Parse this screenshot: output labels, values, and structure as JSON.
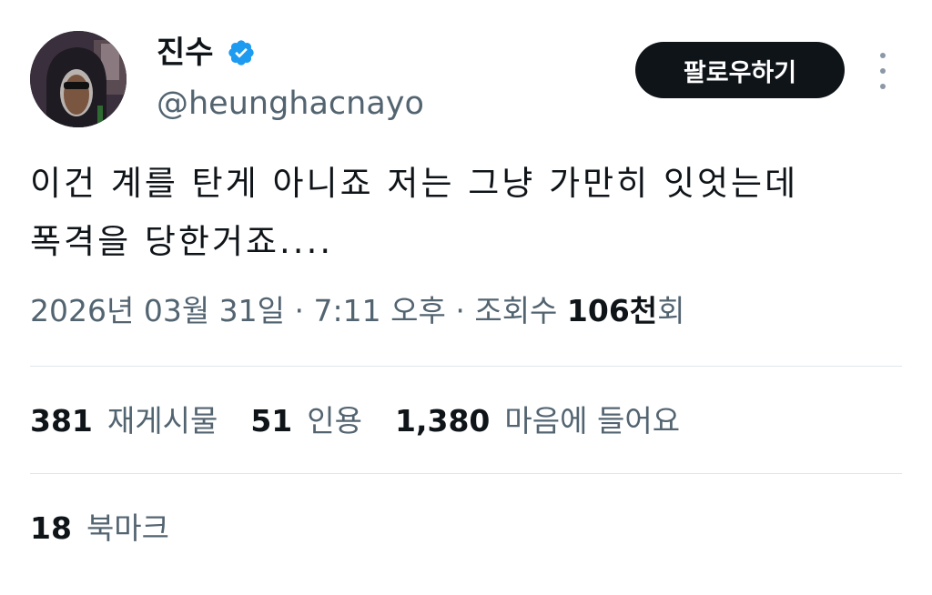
{
  "user": {
    "display_name": "진수",
    "handle": "@heunghacnayo",
    "verified_icon": "verified-badge-icon",
    "avatar_icon": "avatar-with-sunglasses"
  },
  "actions": {
    "follow_label": "팔로우하기",
    "more_icon": "more-vertical-icon"
  },
  "tweet": {
    "text": "이건 계를 탄게 아니죠 저는 그냥 가만히 잇엇는데\n폭격을 당한거죠...."
  },
  "meta": {
    "date": "2026년 03월 31일",
    "sep1": " · ",
    "time": "7:11 오후",
    "sep2": " · ",
    "views_prefix": "조회수 ",
    "views_count": "106천",
    "views_suffix": "회"
  },
  "stats": {
    "retweets_count": "381",
    "retweets_label": "재게시물",
    "quotes_count": "51",
    "quotes_label": "인용",
    "likes_count": "1,380",
    "likes_label": "마음에 들어요",
    "bookmarks_count": "18",
    "bookmarks_label": "북마크"
  },
  "colors": {
    "text_primary": "#0f1419",
    "text_secondary": "#536471",
    "verified_blue": "#1d9bf0",
    "divider": "#e1e6ea"
  }
}
